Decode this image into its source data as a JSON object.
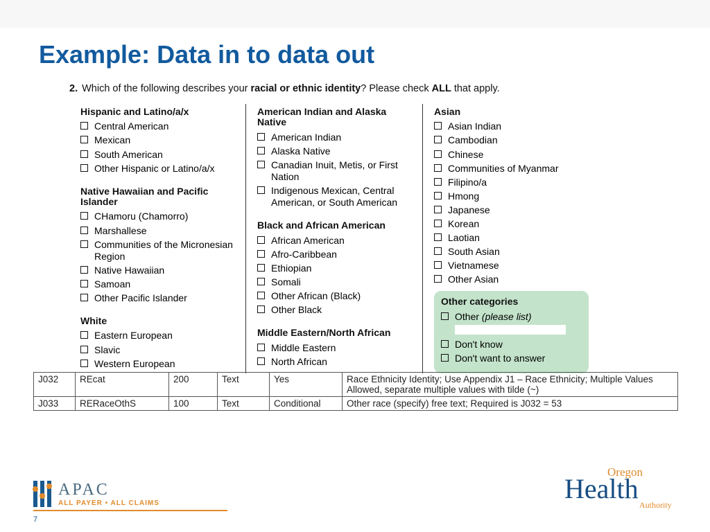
{
  "title": "Example: Data in to data out",
  "question": {
    "num": "2.",
    "pre": "Which of the following describes your ",
    "bold1": "racial or ethnic identity",
    "mid": "? Please check ",
    "bold2": "ALL",
    "post": " that apply."
  },
  "col1": {
    "g1": {
      "h": "Hispanic and Latino/a/x",
      "o": [
        "Central American",
        "Mexican",
        "South American",
        "Other Hispanic or Latino/a/x"
      ]
    },
    "g2": {
      "h": "Native Hawaiian and Pacific Islander",
      "o": [
        "CHamoru (Chamorro)",
        "Marshallese",
        "Communities of the Micronesian Region",
        "Native Hawaiian",
        "Samoan",
        "Other Pacific Islander"
      ]
    },
    "g3": {
      "h": "White",
      "o": [
        "Eastern European",
        "Slavic",
        "Western European"
      ]
    }
  },
  "col2": {
    "g1": {
      "h": "American Indian and Alaska Native",
      "o": [
        "American Indian",
        "Alaska Native",
        "Canadian Inuit, Metis, or First Nation",
        "Indigenous Mexican, Central American, or South American"
      ]
    },
    "g2": {
      "h": "Black and African American",
      "o": [
        "African American",
        "Afro-Caribbean",
        "Ethiopian",
        "Somali",
        "Other African (Black)",
        "Other Black"
      ]
    },
    "g3": {
      "h": "Middle Eastern/North African",
      "o": [
        "Middle Eastern",
        "North African"
      ]
    }
  },
  "col3": {
    "g1": {
      "h": "Asian",
      "o": [
        "Asian Indian",
        "Cambodian",
        "Chinese",
        "Communities of Myanmar",
        "Filipino/a",
        "Hmong",
        "Japanese",
        "Korean",
        "Laotian",
        "South Asian",
        "Vietnamese",
        "Other Asian"
      ]
    },
    "other": {
      "h": "Other categories",
      "o1": "Other ",
      "o1i": "(please list)",
      "o2": "Don't know",
      "o3": "Don't want to answer"
    }
  },
  "table": {
    "r1": {
      "c1": "J032",
      "c2": "REcat",
      "c3": "200",
      "c4": "Text",
      "c5": "Yes",
      "c6": "Race Ethnicity Identity; Use Appendix J1 – Race Ethnicity; Multiple Values Allowed, separate multiple values with tilde (~)"
    },
    "r2": {
      "c1": "J033",
      "c2": "RERaceOthS",
      "c3": "100",
      "c4": "Text",
      "c5": "Conditional",
      "c6": "Other race (specify) free text; Required is J032 = 53"
    }
  },
  "footer": {
    "apac_big": "APAC",
    "apac_small": "ALL PAYER • ALL CLAIMS",
    "page": "7",
    "oha_oregon": "Oregon",
    "oha_health": "Health",
    "oha_auth": "Authority"
  }
}
